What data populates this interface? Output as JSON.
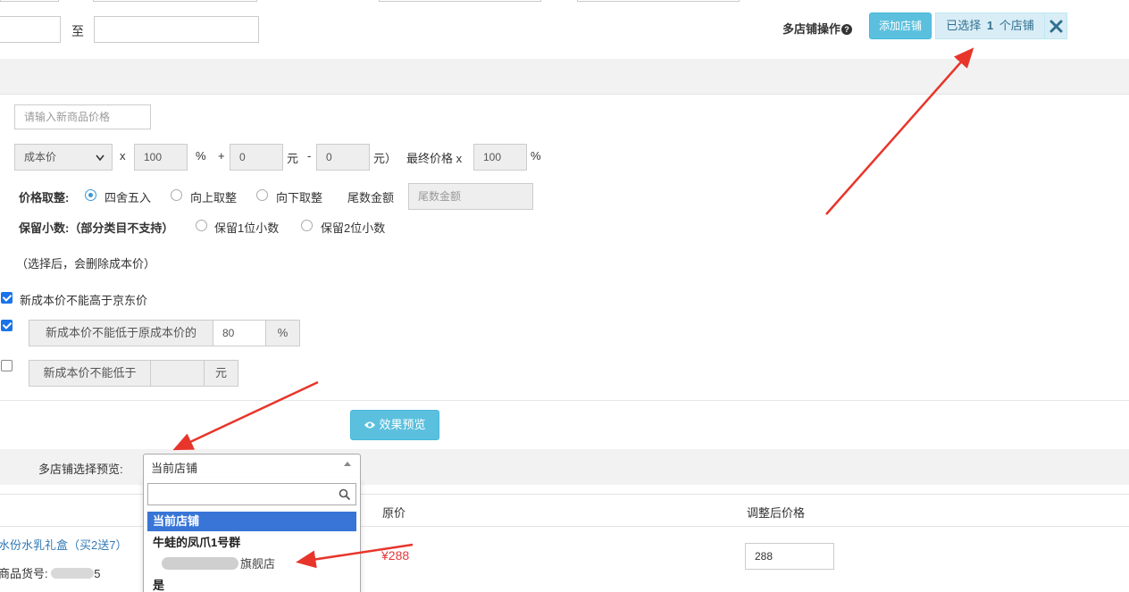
{
  "filter": {
    "range_separator": "至"
  },
  "multi_store": {
    "label": "多店铺操作",
    "help_icon": "question-circle-icon",
    "add_button": "添加店铺",
    "selected_prefix": "已选择",
    "selected_count": "1",
    "selected_suffix": "个店铺",
    "clear_icon": "times-icon"
  },
  "pricing": {
    "new_price_placeholder": "请输入新商品价格",
    "base_select": "成本价",
    "multiply": "x",
    "percent_value": "100",
    "percent": "%",
    "plus": "+",
    "add_value": "0",
    "yuan": "元",
    "minus": "-",
    "sub_value": "0",
    "yuan_paren": "元）",
    "final_label": "最终价格 x",
    "final_value": "100",
    "final_percent": "%"
  },
  "rounding": {
    "label": "价格取整:",
    "options": [
      "四舍五入",
      "向上取整",
      "向下取整"
    ],
    "tail_label": "尾数金额",
    "tail_placeholder": "尾数金额"
  },
  "decimals": {
    "label": "保留小数:（部分类目不支持）",
    "options": [
      "保留1位小数",
      "保留2位小数"
    ]
  },
  "note": "（选择后，会删除成本价）",
  "constraints": {
    "c1_label": "新成本价不能高于京东价",
    "c2_label": "新成本价不能低于原成本价的",
    "c2_value": "80",
    "c2_unit": "%",
    "c3_label": "新成本价不能低于",
    "c3_value": "",
    "c3_unit": "元"
  },
  "preview_button": "效果预览",
  "store_preview": {
    "label": "多店铺选择预览:",
    "selected": "当前店铺",
    "options": [
      "当前店铺",
      "牛蛙的凤爪1号群",
      "旗舰店",
      "是"
    ]
  },
  "table": {
    "headers": {
      "original_price": "原价",
      "adjusted_price": "调整后价格"
    },
    "row": {
      "product_name": "水份水乳礼盒（买2送7）",
      "sku_label": "商品货号:",
      "sku_value": "5",
      "original_price": "¥288",
      "adjusted_price": "288"
    }
  },
  "colors": {
    "info": "#5bc0de",
    "selected_bg": "#d9edf7",
    "link": "#337ab7",
    "price_red": "#e4393c",
    "dropdown_highlight": "#3875d7",
    "arrow_red": "#e8352b"
  }
}
